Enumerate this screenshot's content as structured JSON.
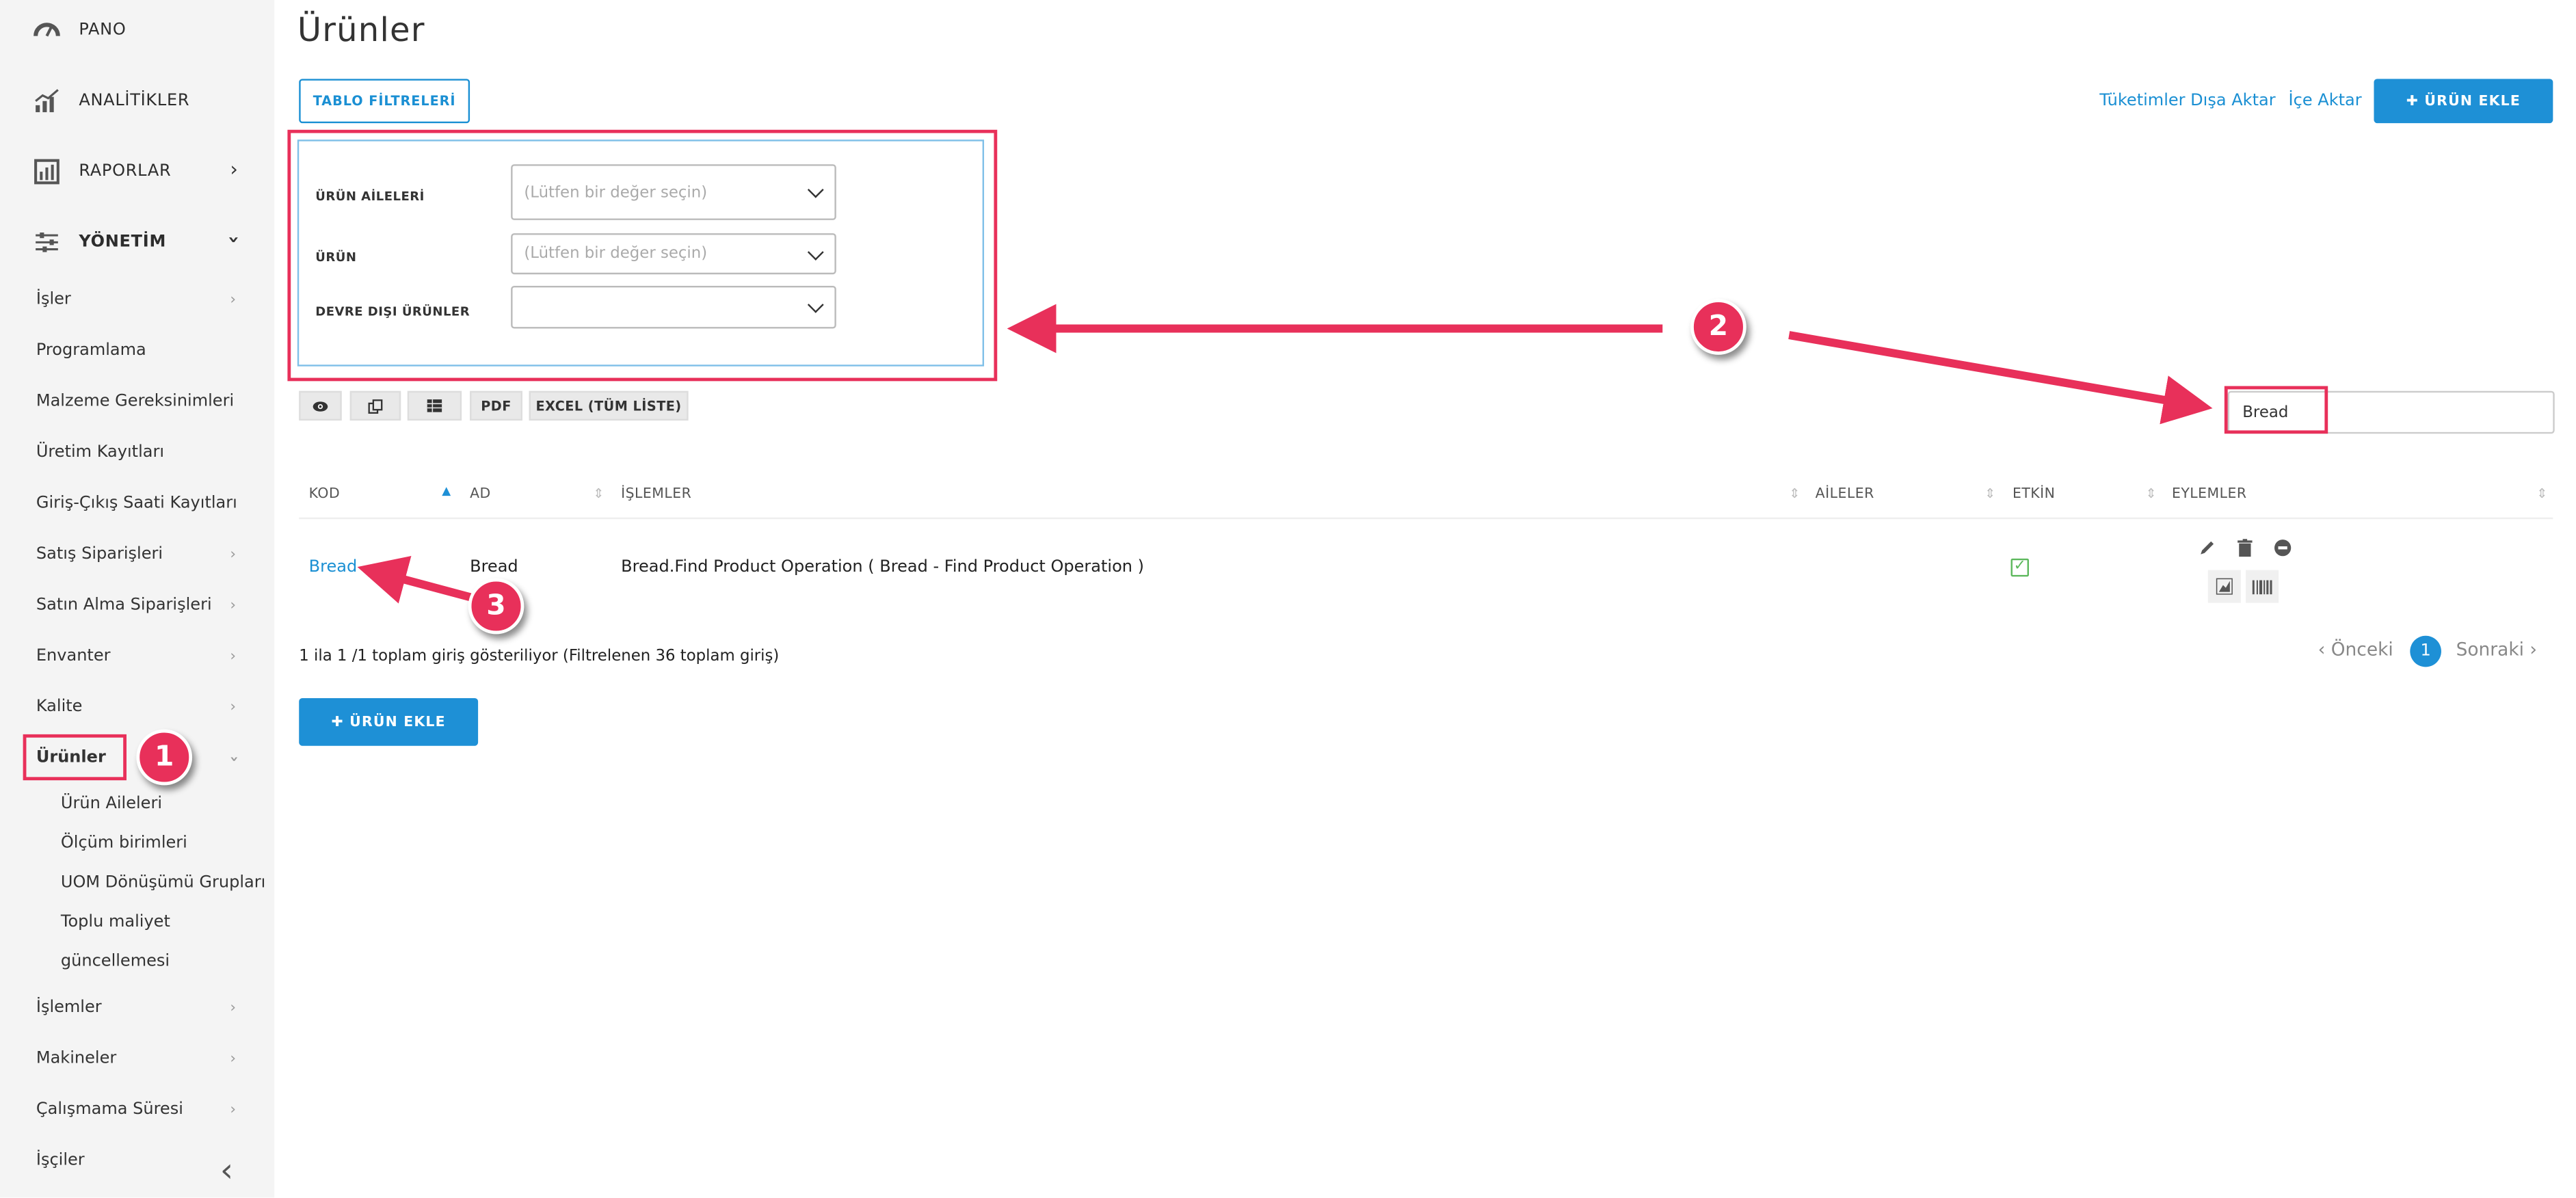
{
  "sidebar": {
    "top": [
      {
        "label": "PANO",
        "icon": "dashboard-icon"
      },
      {
        "label": "ANALİTİKLER",
        "icon": "analytics-icon"
      },
      {
        "label": "RAPORLAR",
        "icon": "reports-icon"
      },
      {
        "label": "YÖNETİM",
        "icon": "settings-sliders-icon"
      }
    ],
    "items": [
      {
        "label": "İşler"
      },
      {
        "label": "Programlama"
      },
      {
        "label": "Malzeme Gereksinimleri"
      },
      {
        "label": "Üretim Kayıtları"
      },
      {
        "label": "Giriş-Çıkış Saati Kayıtları"
      },
      {
        "label": "Satış Siparişleri"
      },
      {
        "label": "Satın Alma Siparişleri"
      },
      {
        "label": "Envanter"
      },
      {
        "label": "Kalite"
      },
      {
        "label": "Ürünler"
      }
    ],
    "subitems": [
      {
        "label": "Ürün Aileleri"
      },
      {
        "label": "Ölçüm birimleri"
      },
      {
        "label": "UOM Dönüşümü Grupları"
      },
      {
        "label": "Toplu maliyet"
      },
      {
        "label": "güncellemesi"
      }
    ],
    "bottom": [
      {
        "label": "İşlemler"
      },
      {
        "label": "Makineler"
      },
      {
        "label": "Çalışmama Süresi"
      },
      {
        "label": "İşçiler"
      }
    ]
  },
  "page": {
    "title": "Ürünler",
    "table_filters_button": "TABLO FİLTRELERİ",
    "export_link": "Tüketimler Dışa Aktar",
    "import_link": "İçe Aktar",
    "add_product_button": "✚ ÜRÜN EKLE"
  },
  "filters": [
    {
      "label": "ÜRÜN AİLELERİ",
      "placeholder": "(Lütfen bir değer seçin)"
    },
    {
      "label": "ÜRÜN",
      "placeholder": "(Lütfen bir değer seçin)"
    },
    {
      "label": "DEVRE DIŞI ÜRÜNLER",
      "placeholder": ""
    }
  ],
  "toolbar": {
    "view_icon": "eye-icon",
    "copy_icon": "copy-icon",
    "columns_icon": "columns-icon",
    "pdf": "PDF",
    "excel": "EXCEL (TÜM LİSTE)"
  },
  "search": {
    "value": "Bread"
  },
  "table": {
    "headers": [
      "KOD",
      "AD",
      "İŞLEMLER",
      "AİLELER",
      "ETKİN",
      "EYLEMLER"
    ],
    "rows": [
      {
        "kod": "Bread",
        "ad": "Bread",
        "islemler": "Bread.Find Product Operation ( Bread - Find Product Operation )",
        "aileler": "",
        "etkin": true
      }
    ]
  },
  "pagination": {
    "info": "1 ila 1 /1 toplam giriş gösteriliyor (Filtrelenen 36 toplam giriş)",
    "prev": "‹ Önceki",
    "current": "1",
    "next": "Sonraki ›"
  },
  "annotations": [
    "1",
    "2",
    "3"
  ],
  "colors": {
    "accent": "#1e90d6",
    "highlight": "#e8305a",
    "sidebar_bg": "#f4f4f4"
  }
}
